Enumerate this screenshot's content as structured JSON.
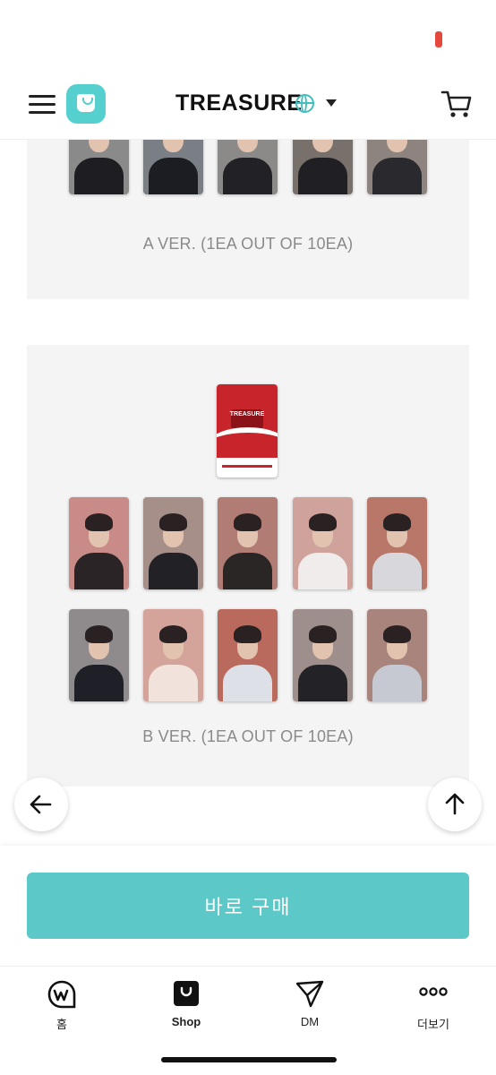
{
  "header": {
    "artist_name": "TREASURE",
    "icons": [
      "hamburger-menu-icon",
      "shop-logo-icon",
      "globe-icon",
      "dropdown-caret-icon",
      "cart-icon"
    ]
  },
  "panels": [
    {
      "id": "a",
      "label": "A VER. (1EA OUT OF 10EA)",
      "visible_cards": 5
    },
    {
      "id": "b",
      "label": "B VER. (1EA OUT OF 10EA)",
      "intro_card_text": "TREASURE",
      "visible_cards": 10
    }
  ],
  "buttons": {
    "buy_now": "바로 구매"
  },
  "tabbar": {
    "items": [
      {
        "label": "홈",
        "icon": "weverse-home-icon"
      },
      {
        "label": "Shop",
        "icon": "shop-bag-icon"
      },
      {
        "label": "DM",
        "icon": "paper-plane-icon"
      },
      {
        "label": "더보기",
        "icon": "more-dots-icon"
      }
    ]
  },
  "colors": {
    "accent": "#5cc9c8",
    "logo": "#56cfcf",
    "panel_bg": "#f4f4f4",
    "label_gray": "#8a8a8a",
    "intro_red": "#c8242c",
    "status_red": "#e5483d"
  }
}
